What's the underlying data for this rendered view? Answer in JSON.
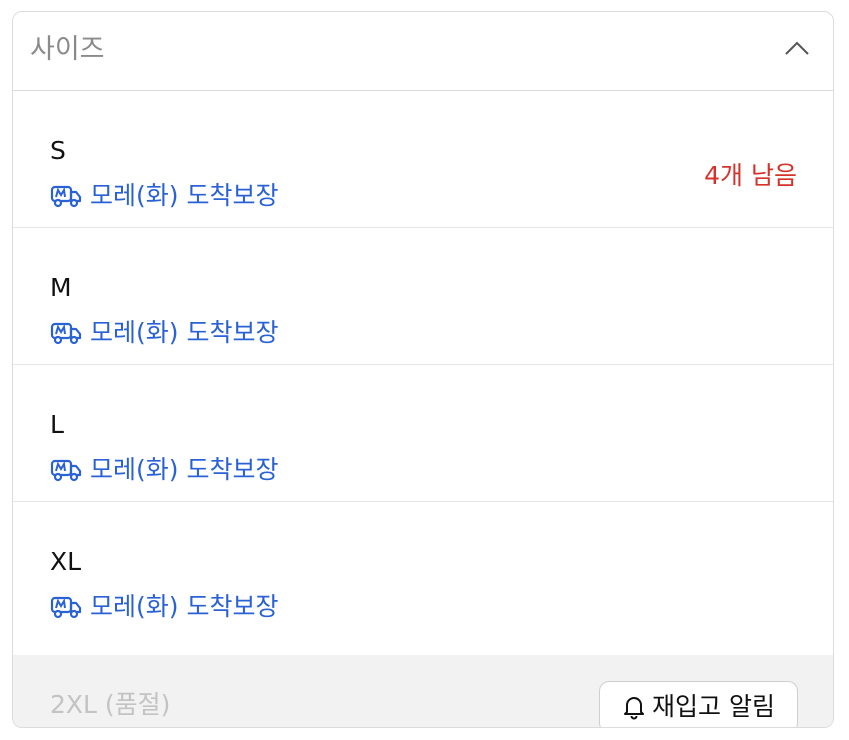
{
  "dropdown": {
    "title": "사이즈",
    "chevron_icon": "chevron-up-icon"
  },
  "options": [
    {
      "size": "S",
      "delivery": "모레(화) 도착보장",
      "stock": "4개 남음"
    },
    {
      "size": "M",
      "delivery": "모레(화) 도착보장"
    },
    {
      "size": "L",
      "delivery": "모레(화) 도착보장"
    },
    {
      "size": "XL",
      "delivery": "모레(화) 도착보장"
    }
  ],
  "soldout": {
    "label": "2XL (품절)",
    "restock_button": "재입고 알림",
    "bell_icon": "bell-icon"
  },
  "colors": {
    "delivery_blue": "#2a62d6",
    "stock_red": "#d6322b",
    "soldout_bg": "#f2f2f2",
    "soldout_text": "#c3c3c3"
  },
  "delivery_icon": "delivery-truck-icon"
}
